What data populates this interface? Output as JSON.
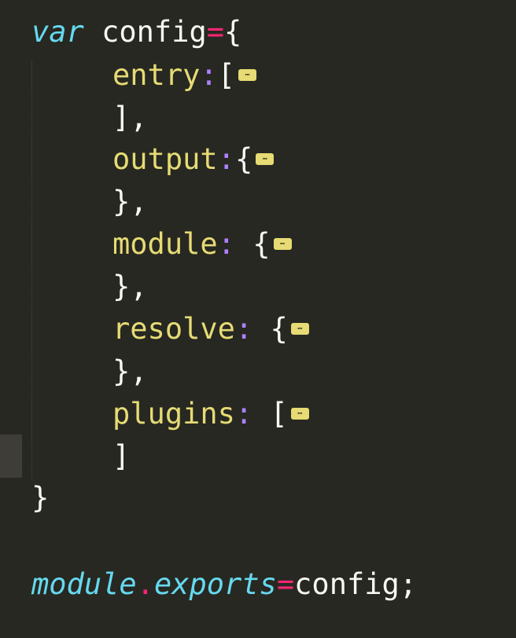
{
  "code": {
    "line1": {
      "keyword": "var",
      "name": " config",
      "op": "=",
      "brace": "{"
    },
    "line2": {
      "key": "entry",
      "colon": ":",
      "bracket": "[",
      "fold": "⋯"
    },
    "line3": {
      "close": "],"
    },
    "line4": {
      "key": "output",
      "colon": ":",
      "bracket": "{",
      "fold": "⋯"
    },
    "line5": {
      "close": "},"
    },
    "line6": {
      "key": "module",
      "colon": ":",
      "bracket": " {",
      "fold": "⋯"
    },
    "line7": {
      "close": "},"
    },
    "line8": {
      "key": "resolve",
      "colon": ":",
      "bracket": " {",
      "fold": "⋯"
    },
    "line9": {
      "close": "},"
    },
    "line10": {
      "key": "plugins",
      "colon": ":",
      "bracket": " [",
      "fold": "⋯"
    },
    "line11": {
      "close": "]"
    },
    "line12": {
      "close": "}"
    },
    "line13": {
      "obj": "module",
      "dot": ".",
      "prop": "exports",
      "op": "=",
      "value": "config;"
    }
  },
  "colors": {
    "background": "#272822",
    "keyword": "#66d9ef",
    "operator": "#f92672",
    "key": "#e6db74",
    "colon": "#ae81ff",
    "text": "#f8f8f2"
  }
}
